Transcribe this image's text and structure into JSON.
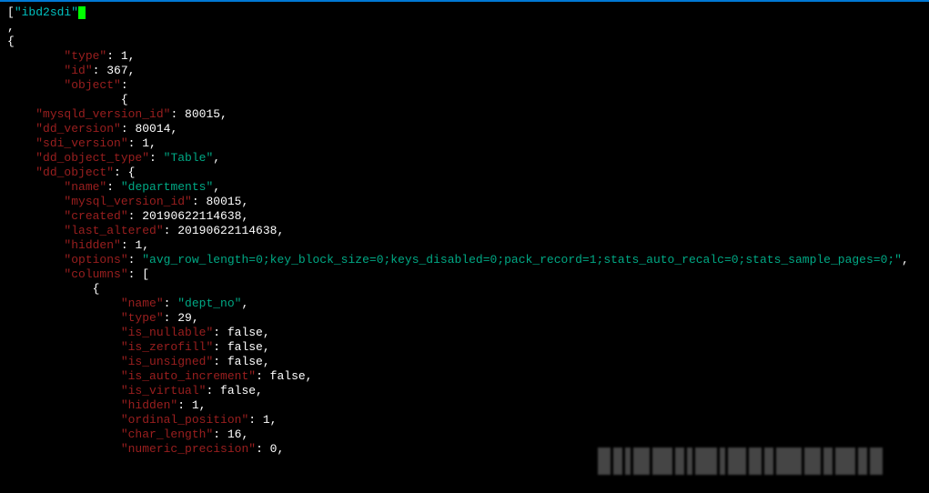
{
  "header": {
    "token": "ibd2sdi"
  },
  "lines": [
    {
      "indent": 0,
      "segments": [
        {
          "cls": "p",
          "text": "["
        },
        {
          "cls": "h",
          "text": "\"ibd2sdi\""
        },
        {
          "cls": "cursor",
          "text": ""
        }
      ]
    },
    {
      "indent": 0,
      "segments": [
        {
          "cls": "p",
          "text": ","
        }
      ]
    },
    {
      "indent": 0,
      "segments": [
        {
          "cls": "p",
          "text": "{"
        }
      ]
    },
    {
      "indent": 8,
      "segments": [
        {
          "cls": "k",
          "text": "\"type\""
        },
        {
          "cls": "p",
          "text": ": 1,"
        }
      ]
    },
    {
      "indent": 8,
      "segments": [
        {
          "cls": "k",
          "text": "\"id\""
        },
        {
          "cls": "p",
          "text": ": 367,"
        }
      ]
    },
    {
      "indent": 8,
      "segments": [
        {
          "cls": "k",
          "text": "\"object\""
        },
        {
          "cls": "p",
          "text": ":"
        }
      ]
    },
    {
      "indent": 16,
      "segments": [
        {
          "cls": "p",
          "text": "{"
        }
      ]
    },
    {
      "indent": 4,
      "segments": [
        {
          "cls": "k",
          "text": "\"mysqld_version_id\""
        },
        {
          "cls": "p",
          "text": ": 80015,"
        }
      ]
    },
    {
      "indent": 4,
      "segments": [
        {
          "cls": "k",
          "text": "\"dd_version\""
        },
        {
          "cls": "p",
          "text": ": 80014,"
        }
      ]
    },
    {
      "indent": 4,
      "segments": [
        {
          "cls": "k",
          "text": "\"sdi_version\""
        },
        {
          "cls": "p",
          "text": ": 1,"
        }
      ]
    },
    {
      "indent": 4,
      "segments": [
        {
          "cls": "k",
          "text": "\"dd_object_type\""
        },
        {
          "cls": "p",
          "text": ": "
        },
        {
          "cls": "s",
          "text": "\"Table\""
        },
        {
          "cls": "p",
          "text": ","
        }
      ]
    },
    {
      "indent": 4,
      "segments": [
        {
          "cls": "k",
          "text": "\"dd_object\""
        },
        {
          "cls": "p",
          "text": ": {"
        }
      ]
    },
    {
      "indent": 8,
      "segments": [
        {
          "cls": "k",
          "text": "\"name\""
        },
        {
          "cls": "p",
          "text": ": "
        },
        {
          "cls": "s",
          "text": "\"departments\""
        },
        {
          "cls": "p",
          "text": ","
        }
      ]
    },
    {
      "indent": 8,
      "segments": [
        {
          "cls": "k",
          "text": "\"mysql_version_id\""
        },
        {
          "cls": "p",
          "text": ": 80015,"
        }
      ]
    },
    {
      "indent": 8,
      "segments": [
        {
          "cls": "k",
          "text": "\"created\""
        },
        {
          "cls": "p",
          "text": ": 20190622114638,"
        }
      ]
    },
    {
      "indent": 8,
      "segments": [
        {
          "cls": "k",
          "text": "\"last_altered\""
        },
        {
          "cls": "p",
          "text": ": 20190622114638,"
        }
      ]
    },
    {
      "indent": 8,
      "segments": [
        {
          "cls": "k",
          "text": "\"hidden\""
        },
        {
          "cls": "p",
          "text": ": 1,"
        }
      ]
    },
    {
      "indent": 8,
      "segments": [
        {
          "cls": "k",
          "text": "\"options\""
        },
        {
          "cls": "p",
          "text": ": "
        },
        {
          "cls": "s",
          "text": "\"avg_row_length=0;key_block_size=0;keys_disabled=0;pack_record=1;stats_auto_recalc=0;stats_sample_pages=0;\""
        },
        {
          "cls": "p",
          "text": ","
        }
      ]
    },
    {
      "indent": 8,
      "segments": [
        {
          "cls": "k",
          "text": "\"columns\""
        },
        {
          "cls": "p",
          "text": ": ["
        }
      ]
    },
    {
      "indent": 12,
      "segments": [
        {
          "cls": "p",
          "text": "{"
        }
      ]
    },
    {
      "indent": 16,
      "segments": [
        {
          "cls": "k",
          "text": "\"name\""
        },
        {
          "cls": "p",
          "text": ": "
        },
        {
          "cls": "s",
          "text": "\"dept_no\""
        },
        {
          "cls": "p",
          "text": ","
        }
      ]
    },
    {
      "indent": 16,
      "segments": [
        {
          "cls": "k",
          "text": "\"type\""
        },
        {
          "cls": "p",
          "text": ": 29,"
        }
      ]
    },
    {
      "indent": 16,
      "segments": [
        {
          "cls": "k",
          "text": "\"is_nullable\""
        },
        {
          "cls": "p",
          "text": ": false,"
        }
      ]
    },
    {
      "indent": 16,
      "segments": [
        {
          "cls": "k",
          "text": "\"is_zerofill\""
        },
        {
          "cls": "p",
          "text": ": false,"
        }
      ]
    },
    {
      "indent": 16,
      "segments": [
        {
          "cls": "k",
          "text": "\"is_unsigned\""
        },
        {
          "cls": "p",
          "text": ": false,"
        }
      ]
    },
    {
      "indent": 16,
      "segments": [
        {
          "cls": "k",
          "text": "\"is_auto_increment\""
        },
        {
          "cls": "p",
          "text": ": false,"
        }
      ]
    },
    {
      "indent": 16,
      "segments": [
        {
          "cls": "k",
          "text": "\"is_virtual\""
        },
        {
          "cls": "p",
          "text": ": false,"
        }
      ]
    },
    {
      "indent": 16,
      "segments": [
        {
          "cls": "k",
          "text": "\"hidden\""
        },
        {
          "cls": "p",
          "text": ": 1,"
        }
      ]
    },
    {
      "indent": 16,
      "segments": [
        {
          "cls": "k",
          "text": "\"ordinal_position\""
        },
        {
          "cls": "p",
          "text": ": 1,"
        }
      ]
    },
    {
      "indent": 16,
      "segments": [
        {
          "cls": "k",
          "text": "\"char_length\""
        },
        {
          "cls": "p",
          "text": ": 16,"
        }
      ]
    },
    {
      "indent": 16,
      "segments": [
        {
          "cls": "k",
          "text": "\"numeric_precision\""
        },
        {
          "cls": "p",
          "text": ": 0,"
        }
      ]
    }
  ],
  "watermark_blocks": [
    14,
    10,
    6,
    18,
    22,
    10,
    6,
    24,
    6,
    20,
    14,
    10,
    28,
    18,
    10,
    22,
    10,
    14
  ]
}
